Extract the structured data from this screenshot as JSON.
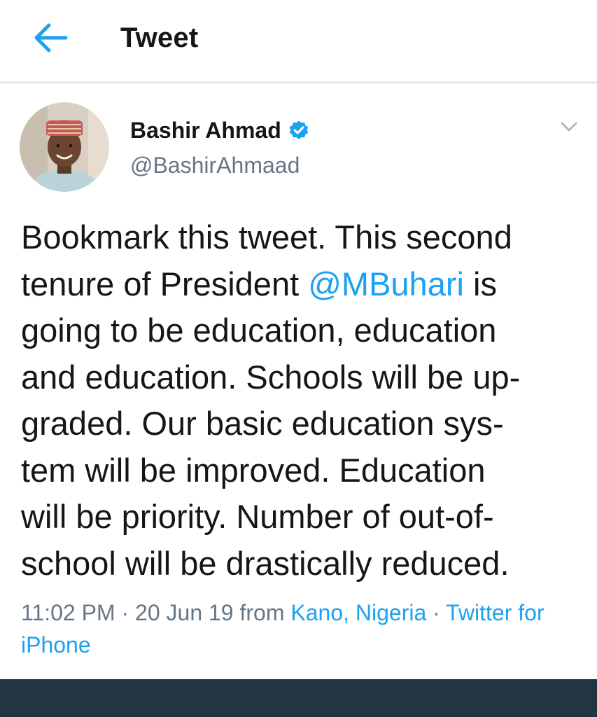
{
  "header": {
    "title": "Tweet",
    "back_icon": "arrow-left-icon",
    "accent_color": "#1da1f2"
  },
  "tweet": {
    "author": {
      "display_name": "Bashir Ahmad",
      "handle": "@BashirAhmaad",
      "verified_icon": "verified-badge-icon"
    },
    "caret_icon": "chevron-down-icon",
    "text": {
      "part1": "Bookmark this tweet. This second\ntenure of President ",
      "mention": "@MBuhari",
      "part2": " is\ngoing to be education, education\nand education. Schools will be up-\ngraded. Our basic education sys-\ntem will be improved. Education\nwill be priority. Number of out-of-\nschool will be drastically reduced."
    },
    "meta": {
      "time": "11:02 PM",
      "sep1": " · ",
      "date": "20 Jun 19",
      "from_label": " from ",
      "location": "Kano, Nigeria",
      "sep2": " · ",
      "source": "Twitter for iPhone"
    }
  },
  "colors": {
    "link": "#1da1f2",
    "secondary_text": "#657786",
    "primary_text": "#14171a",
    "bottom_bar": "#243442"
  }
}
